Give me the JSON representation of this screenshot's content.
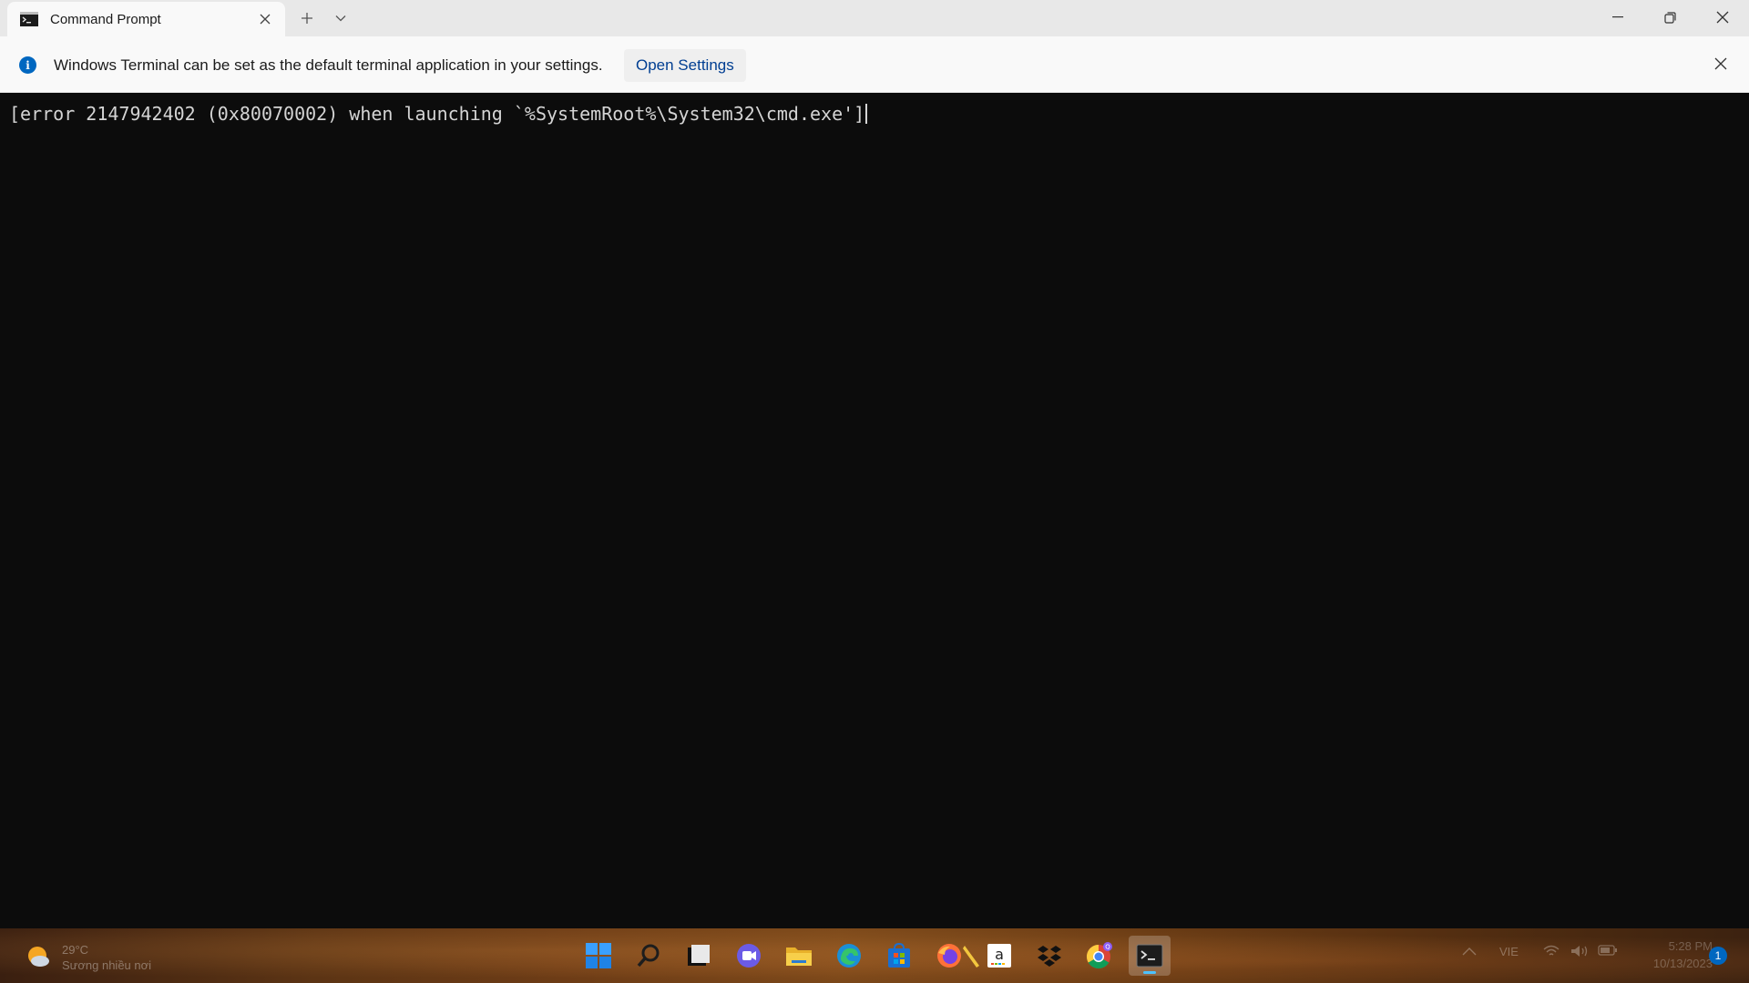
{
  "window": {
    "tab_title": "Command Prompt",
    "new_tab_glyph": "+",
    "dropdown_glyph": "chevron-down-icon"
  },
  "infobar": {
    "message": "Windows Terminal can be set as the default terminal application in your settings.",
    "action_label": "Open Settings",
    "icon": "info-icon",
    "icon_glyph": "i"
  },
  "terminal": {
    "output_line": "[error 2147942402 (0x80070002) when launching `%SystemRoot%\\System32\\cmd.exe']"
  },
  "taskbar": {
    "weather": {
      "temp": "29°C",
      "desc": "Sương nhiều nơi"
    },
    "apps": [
      "start-icon",
      "search-icon",
      "task-view-icon",
      "teams-chat-icon",
      "file-explorer-icon",
      "edge-icon",
      "microsoft-store-icon",
      "firefox-icon",
      "pen-icon",
      "amazon-icon",
      "dropbox-icon",
      "chrome-icon",
      "terminal-icon"
    ],
    "tray": {
      "language": "VIE",
      "time": "5:28 PM",
      "date": "10/13/2023",
      "notification_count": "1"
    }
  },
  "colors": {
    "accent": "#0067c0",
    "terminal_bg": "#0c0c0c",
    "terminal_fg": "#d4d4d4",
    "link": "#003e92"
  }
}
